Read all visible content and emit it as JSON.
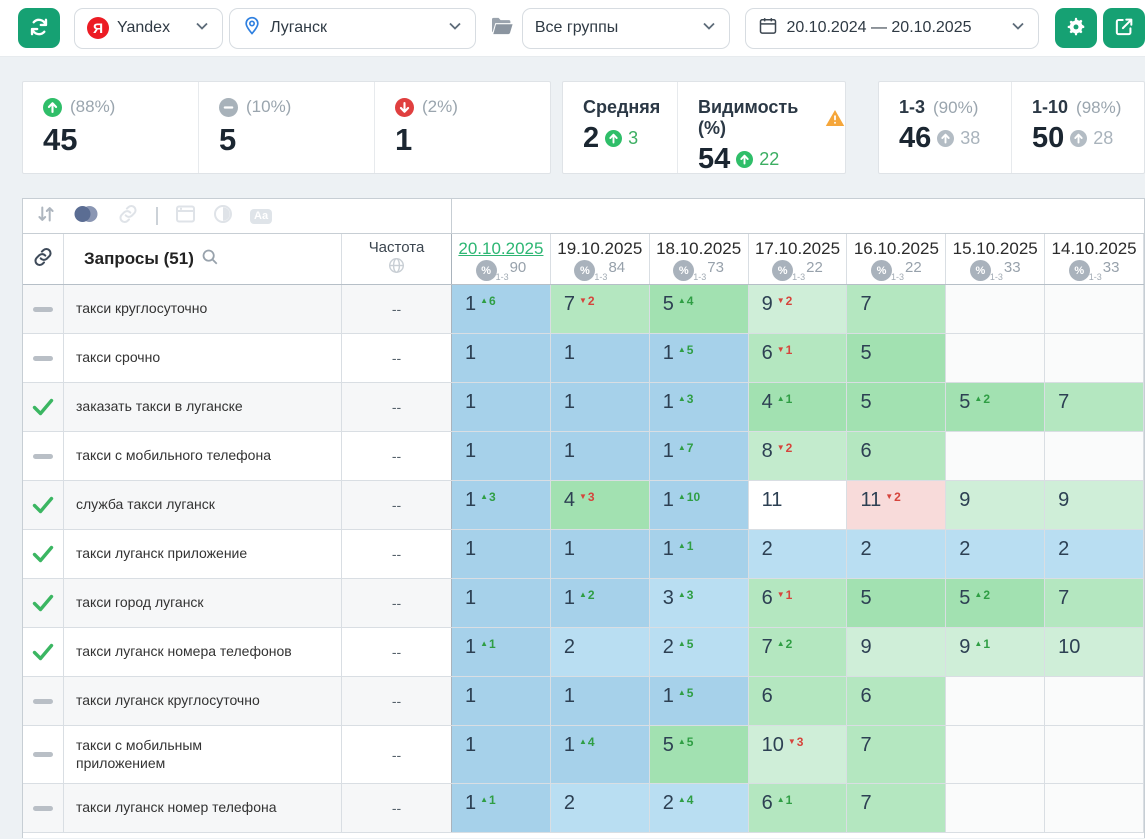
{
  "topbar": {
    "search_engine": "Yandex",
    "region": "Луганск",
    "group_filter": "Все группы",
    "date_range": "20.10.2024 — 20.10.2025"
  },
  "icons": {
    "yandex_letter": "Я",
    "aa_label": "Aa",
    "list": [
      "refresh-icon",
      "yandex-icon",
      "location-pin-icon",
      "folder-icon",
      "calendar-icon",
      "gear-icon",
      "export-icon",
      "sort-icon",
      "layers-toggle-icon",
      "link-icon",
      "columns-icon",
      "contrast-icon",
      "font-size-icon",
      "search-icon",
      "globe-icon",
      "check-icon",
      "dash-icon",
      "percent-badge",
      "warning-icon",
      "chevron-down-icon"
    ]
  },
  "summary": {
    "up": {
      "percent": "(88%)",
      "value": "45"
    },
    "flat": {
      "percent": "(10%)",
      "value": "5"
    },
    "down": {
      "percent": "(2%)",
      "value": "1"
    },
    "average": {
      "label": "Средняя",
      "value": "2",
      "delta": "3"
    },
    "visibility": {
      "label": "Видимость (%)",
      "value": "54",
      "delta": "22"
    },
    "top3": {
      "label": "1-3",
      "percent": "(90%)",
      "value": "46",
      "delta": "38"
    },
    "top10": {
      "label": "1-10",
      "percent": "(98%)",
      "value": "50",
      "delta": "28"
    }
  },
  "table": {
    "queries_label": "Запросы",
    "queries_count": "(51)",
    "frequency_label": "Частота",
    "badge_symbol": "%",
    "badge_range": "1-3",
    "dates": [
      {
        "label": "20.10.2025",
        "percent": "90",
        "selected": true
      },
      {
        "label": "19.10.2025",
        "percent": "84",
        "selected": false
      },
      {
        "label": "18.10.2025",
        "percent": "73",
        "selected": false
      },
      {
        "label": "17.10.2025",
        "percent": "22",
        "selected": false
      },
      {
        "label": "16.10.2025",
        "percent": "22",
        "selected": false
      },
      {
        "label": "15.10.2025",
        "percent": "33",
        "selected": false
      },
      {
        "label": "14.10.2025",
        "percent": "33",
        "selected": false
      }
    ],
    "rows": [
      {
        "checked": false,
        "keyword": "такси круглосуточно",
        "frequency": "--",
        "cells": [
          {
            "v": "1",
            "d": "6",
            "dir": "up",
            "tone": "blue1"
          },
          {
            "v": "7",
            "d": "2",
            "dir": "down",
            "tone": "green2"
          },
          {
            "v": "5",
            "d": "4",
            "dir": "up",
            "tone": "green1"
          },
          {
            "v": "9",
            "d": "2",
            "dir": "down",
            "tone": "green4"
          },
          {
            "v": "7",
            "tone": "green2"
          },
          {
            "tone": "empty"
          },
          {
            "tone": "empty"
          }
        ]
      },
      {
        "checked": false,
        "keyword": "такси срочно",
        "frequency": "--",
        "cells": [
          {
            "v": "1",
            "tone": "blue1"
          },
          {
            "v": "1",
            "tone": "blue1"
          },
          {
            "v": "1",
            "d": "5",
            "dir": "up",
            "tone": "blue1"
          },
          {
            "v": "6",
            "d": "1",
            "dir": "down",
            "tone": "green2"
          },
          {
            "v": "5",
            "tone": "green1"
          },
          {
            "tone": "empty"
          },
          {
            "tone": "empty"
          }
        ]
      },
      {
        "checked": true,
        "keyword": "заказать такси в луганске",
        "frequency": "--",
        "cells": [
          {
            "v": "1",
            "tone": "blue1"
          },
          {
            "v": "1",
            "tone": "blue1"
          },
          {
            "v": "1",
            "d": "3",
            "dir": "up",
            "tone": "blue1"
          },
          {
            "v": "4",
            "d": "1",
            "dir": "up",
            "tone": "green1"
          },
          {
            "v": "5",
            "tone": "green1"
          },
          {
            "v": "5",
            "d": "2",
            "dir": "up",
            "tone": "green1"
          },
          {
            "v": "7",
            "tone": "green2"
          }
        ]
      },
      {
        "checked": false,
        "keyword": "такси с мобильного телефона",
        "frequency": "--",
        "cells": [
          {
            "v": "1",
            "tone": "blue1"
          },
          {
            "v": "1",
            "tone": "blue1"
          },
          {
            "v": "1",
            "d": "7",
            "dir": "up",
            "tone": "blue1"
          },
          {
            "v": "8",
            "d": "2",
            "dir": "down",
            "tone": "green3"
          },
          {
            "v": "6",
            "tone": "green2"
          },
          {
            "tone": "empty"
          },
          {
            "tone": "empty"
          }
        ]
      },
      {
        "checked": true,
        "keyword": "служба такси луганск",
        "frequency": "--",
        "cells": [
          {
            "v": "1",
            "d": "3",
            "dir": "up",
            "tone": "blue1"
          },
          {
            "v": "4",
            "d": "3",
            "dir": "down",
            "tone": "green1"
          },
          {
            "v": "1",
            "d": "10",
            "dir": "up",
            "tone": "blue1"
          },
          {
            "v": "11",
            "tone": "white"
          },
          {
            "v": "11",
            "d": "2",
            "dir": "down",
            "tone": "pink"
          },
          {
            "v": "9",
            "tone": "green4"
          },
          {
            "v": "9",
            "tone": "green4"
          }
        ]
      },
      {
        "checked": true,
        "keyword": "такси луганск приложение",
        "frequency": "--",
        "cells": [
          {
            "v": "1",
            "tone": "blue1"
          },
          {
            "v": "1",
            "tone": "blue1"
          },
          {
            "v": "1",
            "d": "1",
            "dir": "up",
            "tone": "blue1"
          },
          {
            "v": "2",
            "tone": "blue2"
          },
          {
            "v": "2",
            "tone": "blue2"
          },
          {
            "v": "2",
            "tone": "blue2"
          },
          {
            "v": "2",
            "tone": "blue2"
          }
        ]
      },
      {
        "checked": true,
        "keyword": "такси город луганск",
        "frequency": "--",
        "cells": [
          {
            "v": "1",
            "tone": "blue1"
          },
          {
            "v": "1",
            "d": "2",
            "dir": "up",
            "tone": "blue1"
          },
          {
            "v": "3",
            "d": "3",
            "dir": "up",
            "tone": "blue2"
          },
          {
            "v": "6",
            "d": "1",
            "dir": "down",
            "tone": "green2"
          },
          {
            "v": "5",
            "tone": "green1"
          },
          {
            "v": "5",
            "d": "2",
            "dir": "up",
            "tone": "green1"
          },
          {
            "v": "7",
            "tone": "green2"
          }
        ]
      },
      {
        "checked": true,
        "keyword": "такси луганск номера телефонов",
        "frequency": "--",
        "cells": [
          {
            "v": "1",
            "d": "1",
            "dir": "up",
            "tone": "blue1"
          },
          {
            "v": "2",
            "tone": "blue2"
          },
          {
            "v": "2",
            "d": "5",
            "dir": "up",
            "tone": "blue2"
          },
          {
            "v": "7",
            "d": "2",
            "dir": "up",
            "tone": "green2"
          },
          {
            "v": "9",
            "tone": "green4"
          },
          {
            "v": "9",
            "d": "1",
            "dir": "up",
            "tone": "green4"
          },
          {
            "v": "10",
            "tone": "green4"
          }
        ]
      },
      {
        "checked": false,
        "keyword": "такси луганск круглосуточно",
        "frequency": "--",
        "cells": [
          {
            "v": "1",
            "tone": "blue1"
          },
          {
            "v": "1",
            "tone": "blue1"
          },
          {
            "v": "1",
            "d": "5",
            "dir": "up",
            "tone": "blue1"
          },
          {
            "v": "6",
            "tone": "green2"
          },
          {
            "v": "6",
            "tone": "green2"
          },
          {
            "tone": "empty"
          },
          {
            "tone": "empty"
          }
        ]
      },
      {
        "checked": false,
        "tall": true,
        "keyword": "такси с мобильным\nприложением",
        "frequency": "--",
        "cells": [
          {
            "v": "1",
            "tone": "blue1"
          },
          {
            "v": "1",
            "d": "4",
            "dir": "up",
            "tone": "blue1"
          },
          {
            "v": "5",
            "d": "5",
            "dir": "up",
            "tone": "green1"
          },
          {
            "v": "10",
            "d": "3",
            "dir": "down",
            "tone": "green4"
          },
          {
            "v": "7",
            "tone": "green2"
          },
          {
            "tone": "empty"
          },
          {
            "tone": "empty"
          }
        ]
      },
      {
        "checked": false,
        "keyword": "такси луганск номер телефона",
        "frequency": "--",
        "cells": [
          {
            "v": "1",
            "d": "1",
            "dir": "up",
            "tone": "blue1"
          },
          {
            "v": "2",
            "tone": "blue2"
          },
          {
            "v": "2",
            "d": "4",
            "dir": "up",
            "tone": "blue2"
          },
          {
            "v": "6",
            "d": "1",
            "dir": "up",
            "tone": "green2"
          },
          {
            "v": "7",
            "tone": "green2"
          },
          {
            "tone": "empty"
          },
          {
            "tone": "empty"
          }
        ]
      }
    ]
  },
  "colors": {
    "accent_green": "#16a173",
    "link_green": "#2db673",
    "delta_up": "#2f9e44",
    "delta_down": "#d6443c",
    "cell_pos1": "#a6d1ea",
    "cell_pos2_3": "#b9def2",
    "cell_pos4_5": "#a2e1b1",
    "cell_pos6_7": "#b4e7c0",
    "cell_pos8": "#c3ebcd",
    "cell_pos9_10": "#cfeed8",
    "cell_pos11_drop": "#f8dbda",
    "warning_orange": "#f5a63a",
    "yandex_red": "#ec1c24"
  }
}
